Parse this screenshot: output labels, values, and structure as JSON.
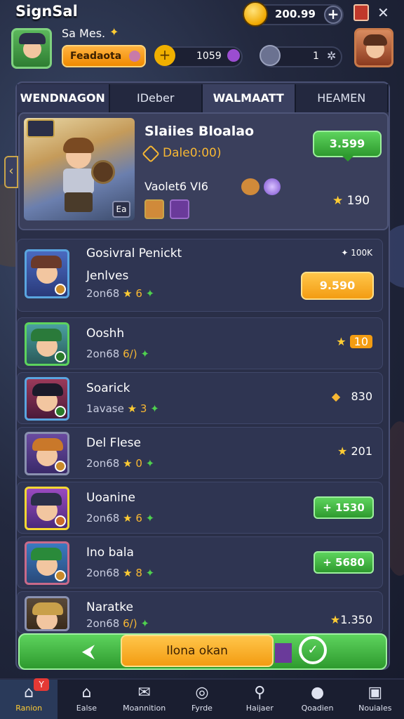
{
  "header": {
    "title": "SignSal",
    "coins": "200.99",
    "player_name": "Sa Mes.",
    "orange_label": "Feadaota",
    "resource1": "1059",
    "resource2": "1"
  },
  "tabs": [
    "WENDNAGON",
    "IDeber",
    "WALMAATT",
    "HEAMEN"
  ],
  "featured": {
    "title": "Slaiies Bloalao",
    "subtitle": "Dale0:00)",
    "row_text": "Vaolet6 VI6",
    "button": "3.599",
    "stars": "190",
    "corner": "Ea"
  },
  "rows": [
    {
      "name": "Gosivral Penickt",
      "name2": "Jenlves",
      "meta_prefix": "2on68",
      "meta_num": "6",
      "top_right": "✦ 100K",
      "button": "9.590",
      "button_type": "gold"
    },
    {
      "name": "Ooshh",
      "meta_prefix": "2on68",
      "meta_num": "6/)",
      "right": "10",
      "button_type": "star"
    },
    {
      "name": "Soarick",
      "meta_prefix": "1avase",
      "meta_num": "3",
      "right": "830",
      "button_type": "diamond"
    },
    {
      "name": "Del Flese",
      "meta_prefix": "2on68",
      "meta_num": "0",
      "right": "201",
      "button_type": "star"
    },
    {
      "name": "Uoanine",
      "meta_prefix": "2on68",
      "meta_num": "6",
      "button": "1530",
      "button_type": "green"
    },
    {
      "name": "Ino bala",
      "meta_prefix": "2on68",
      "meta_num": "8",
      "button": "5680",
      "button_type": "green"
    },
    {
      "name": "Naratke",
      "meta_prefix": "2on68",
      "meta_num": "6/)",
      "right": "1.350",
      "button_type": "star"
    }
  ],
  "bottom": {
    "main_label": "Ilona okan"
  },
  "nav": [
    {
      "label": "Ranion",
      "icon": "home-icon",
      "badge": "Y"
    },
    {
      "label": "Ealse",
      "icon": "home-icon"
    },
    {
      "label": "Moannition",
      "icon": "mail-icon"
    },
    {
      "label": "Fyrde",
      "icon": "map-pin-icon"
    },
    {
      "label": "Haijaer",
      "icon": "search-icon"
    },
    {
      "label": "Qoadien",
      "icon": "person-icon"
    },
    {
      "label": "Nouiales",
      "icon": "gift-icon"
    }
  ],
  "colors": {
    "accent_gold": "#f39c12",
    "accent_green": "#2e9a2e",
    "panel": "#2a2f48"
  }
}
